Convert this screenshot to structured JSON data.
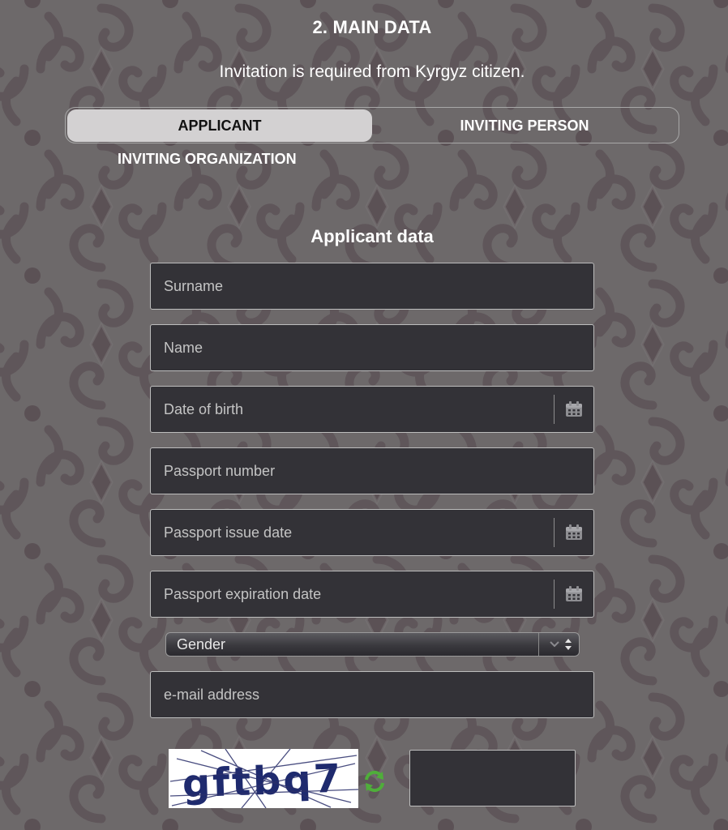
{
  "page": {
    "section_title": "2. MAIN DATA",
    "subtitle": "Invitation is required from Kyrgyz citizen."
  },
  "tabs": [
    {
      "label": "APPLICANT",
      "active": true
    },
    {
      "label": "INVITING PERSON",
      "active": false
    },
    {
      "label": "INVITING ORGANIZATION",
      "active": false
    }
  ],
  "form": {
    "heading": "Applicant data",
    "fields": {
      "surname": {
        "value": "",
        "placeholder": "Surname"
      },
      "name": {
        "value": "",
        "placeholder": "Name"
      },
      "date_of_birth": {
        "value": "",
        "placeholder": "Date of birth"
      },
      "passport_number": {
        "value": "",
        "placeholder": "Passport number"
      },
      "passport_issue_date": {
        "value": "",
        "placeholder": "Passport issue date"
      },
      "passport_expiration_date": {
        "value": "",
        "placeholder": "Passport expiration date"
      },
      "gender": {
        "selected": "Gender"
      },
      "email": {
        "value": "",
        "placeholder": "e-mail address"
      }
    },
    "captcha": {
      "text": "gftbq7",
      "input_value": ""
    }
  },
  "icons": {
    "date_picker": "calendar-icon",
    "captcha_refresh": "refresh-icon",
    "select_toggle": "chevron-up-down-icon"
  },
  "colors": {
    "field_background": "#333237",
    "field_border": "#bdbdbd",
    "active_tab_background": "#d3d1d2",
    "refresh_icon": "#4fae3a",
    "captcha_text": "#1e2a6e"
  }
}
